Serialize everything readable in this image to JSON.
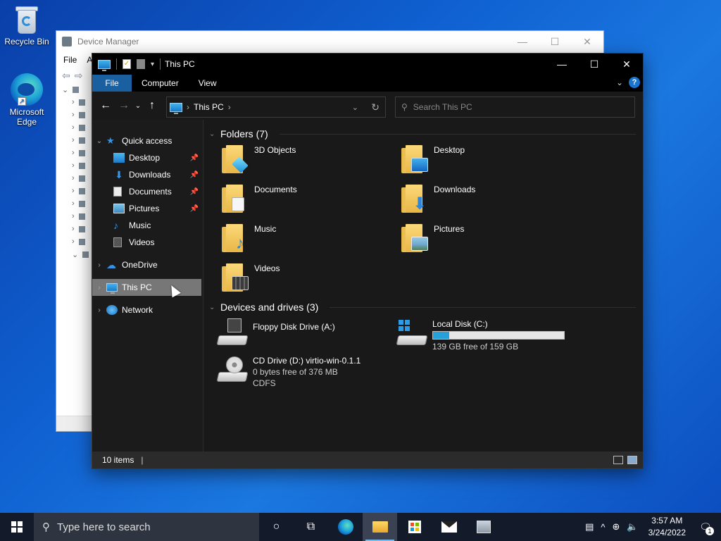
{
  "desktop": {
    "icons": [
      {
        "label": "Recycle Bin"
      },
      {
        "label": "Microsoft Edge"
      }
    ]
  },
  "device_manager": {
    "title": "Device Manager",
    "menu": [
      "File",
      "A"
    ]
  },
  "explorer": {
    "title": "This PC",
    "ribbon_tabs": [
      "File",
      "Computer",
      "View"
    ],
    "address": {
      "location": "This PC"
    },
    "search": {
      "placeholder": "Search This PC"
    },
    "nav": {
      "quick_access": "Quick access",
      "quick_items": [
        {
          "label": "Desktop",
          "pinned": true
        },
        {
          "label": "Downloads",
          "pinned": true
        },
        {
          "label": "Documents",
          "pinned": true
        },
        {
          "label": "Pictures",
          "pinned": true
        },
        {
          "label": "Music",
          "pinned": false
        },
        {
          "label": "Videos",
          "pinned": false
        }
      ],
      "onedrive": "OneDrive",
      "this_pc": "This PC",
      "network": "Network"
    },
    "folders_header": "Folders (7)",
    "folders": [
      "3D Objects",
      "Desktop",
      "Documents",
      "Downloads",
      "Music",
      "Pictures",
      "Videos"
    ],
    "drives_header": "Devices and drives (3)",
    "drives": [
      {
        "name": "Floppy Disk Drive (A:)"
      },
      {
        "name": "Local Disk (C:)",
        "free": "139 GB free of 159 GB",
        "used_fraction": 0.126
      },
      {
        "name": "CD Drive (D:) virtio-win-0.1.1",
        "free": "0 bytes free of 376 MB",
        "fs": "CDFS"
      }
    ],
    "status": "10 items"
  },
  "taskbar": {
    "search_placeholder": "Type here to search",
    "time": "3:57 AM",
    "date": "3/24/2022",
    "notifications": "1"
  },
  "colors": {
    "accent": "#1a5fa0",
    "drive_bar": "#26a0da",
    "selection": "#777777"
  }
}
